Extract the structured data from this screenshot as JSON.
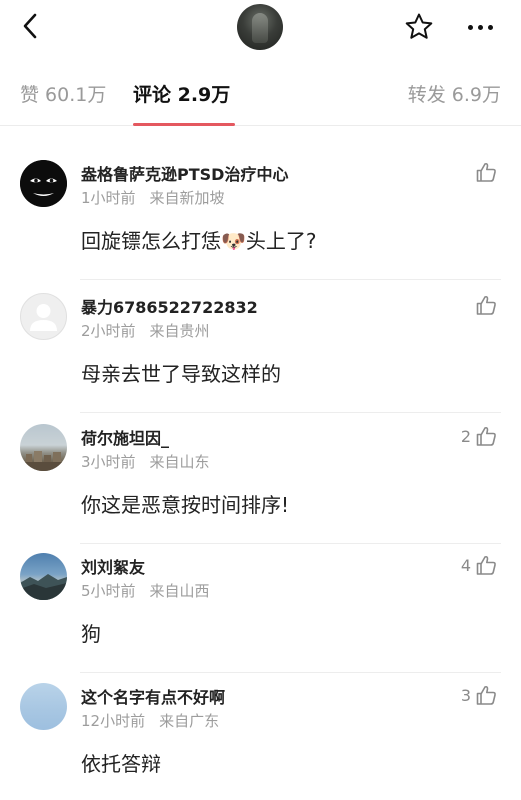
{
  "header": {
    "back_icon": "chevron-left-icon",
    "avatar": "user-avatar",
    "favorite_icon": "star-outline-icon",
    "more_icon": "more-horizontal-icon"
  },
  "tabs": [
    {
      "label": "赞 60.1万",
      "active": false
    },
    {
      "label": "评论 2.9万",
      "active": true
    },
    {
      "label": "转发 6.9万",
      "active": false
    }
  ],
  "colors": {
    "accent": "#e4585f",
    "meta_text": "#9d9d9d",
    "primary_text": "#222222"
  },
  "comments": [
    {
      "username": "盎格鲁萨克逊PTSD治疗中心",
      "time": "1小时前",
      "location": "来自新加坡",
      "text_before": "回旋镖怎么打恁",
      "emoji": "🐶",
      "text_after": "头上了?",
      "likes": "",
      "avatar_style": "black-mask-avatar"
    },
    {
      "username": "暴力6786522722832",
      "time": "2小时前",
      "location": "来自贵州",
      "text": "母亲去世了导致这样的",
      "likes": "",
      "avatar_style": "default-avatar"
    },
    {
      "username": "荷尔施坦因_",
      "time": "3小时前",
      "location": "来自山东",
      "text": "你这是恶意按时间排序!",
      "likes": "2",
      "avatar_style": "town-photo-avatar"
    },
    {
      "username": "刘刘絮友",
      "time": "5小时前",
      "location": "来自山西",
      "text": "狗",
      "likes": "4",
      "avatar_style": "mountain-photo-avatar"
    },
    {
      "username": "这个名字有点不好啊",
      "time": "12小时前",
      "location": "来自广东",
      "text": "依托答辩",
      "likes": "3",
      "avatar_style": "sky-avatar"
    }
  ]
}
